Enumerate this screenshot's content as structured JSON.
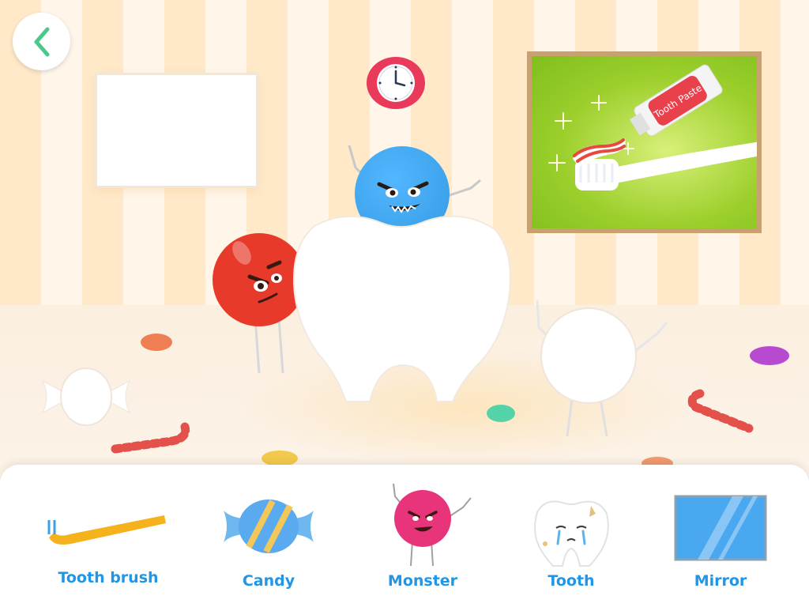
{
  "toolbar": {
    "items": [
      {
        "label": "Tooth brush",
        "icon": "toothbrush-icon"
      },
      {
        "label": "Candy",
        "icon": "candy-icon"
      },
      {
        "label": "Monster",
        "icon": "monster-icon"
      },
      {
        "label": "Tooth",
        "icon": "crying-tooth-icon"
      },
      {
        "label": "Mirror",
        "icon": "mirror-icon"
      }
    ]
  },
  "poster": {
    "tube_label": "Tooth Paste"
  },
  "colors": {
    "label": "#2196e6",
    "wall_stripe": "#ffe9c9",
    "back_arrow": "#4cc98a"
  }
}
